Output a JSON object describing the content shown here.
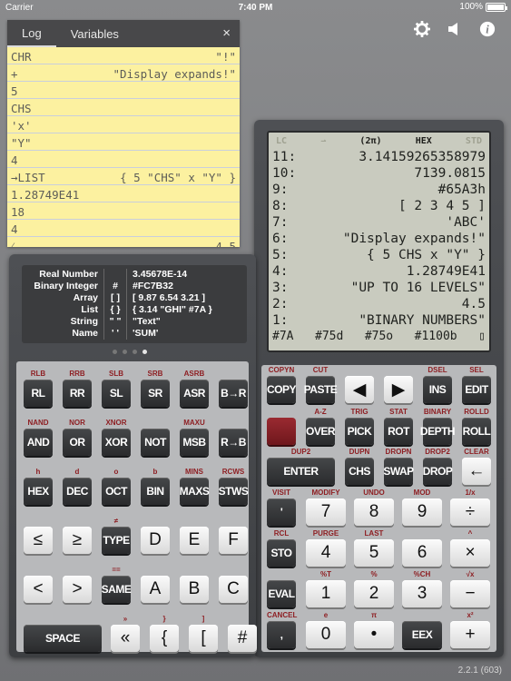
{
  "status": {
    "carrier": "Carrier",
    "time": "7:40 PM",
    "battery": "100%"
  },
  "toolbar": {
    "icons": [
      "gear-icon",
      "speaker-icon",
      "info-icon"
    ]
  },
  "log": {
    "tabs": [
      "Log",
      "Variables"
    ],
    "close": "×",
    "lines": [
      {
        "l": "CHR",
        "r": "\"!\""
      },
      {
        "l": "+",
        "r": "\"Display expands!\""
      },
      {
        "l": "5",
        "r": ""
      },
      {
        "l": "CHS",
        "r": ""
      },
      {
        "l": "'x'",
        "r": ""
      },
      {
        "l": "\"Y\"",
        "r": ""
      },
      {
        "l": "4",
        "r": ""
      },
      {
        "l": "→LIST",
        "r": "{ 5 \"CHS\" x \"Y\" }"
      },
      {
        "l": "1.28749E41",
        "r": ""
      },
      {
        "l": "18",
        "r": ""
      },
      {
        "l": "4",
        "r": ""
      },
      {
        "l": "⁄",
        "r": "4.5"
      }
    ]
  },
  "lcd": {
    "annunciators": {
      "lc": "LC",
      "arrow": "⇀",
      "pi": "(2π)",
      "mode": "HEX",
      "std": "STD"
    },
    "stack": [
      {
        "n": "11:",
        "v": "3.14159265358979"
      },
      {
        "n": "10:",
        "v": "7139.0815"
      },
      {
        "n": "9:",
        "v": "#65A3h"
      },
      {
        "n": "8:",
        "v": "[ 2 3 4 5 ]"
      },
      {
        "n": "7:",
        "v": "'ABC'"
      },
      {
        "n": "6:",
        "v": "\"Display expands!\""
      },
      {
        "n": "5:",
        "v": "{ 5 CHS x \"Y\" }"
      },
      {
        "n": "4:",
        "v": "1.28749E41"
      },
      {
        "n": "3:",
        "v": "\"UP TO 16 LEVELS\""
      },
      {
        "n": "2:",
        "v": "4.5"
      },
      {
        "n": "1:",
        "v": "\"BINARY NUMBERS\""
      }
    ],
    "menu": [
      "#7A",
      "#75d",
      "#75o",
      "#1100b"
    ]
  },
  "types": [
    {
      "name": "Real Number",
      "sym": "",
      "ex": "3.45678E-14"
    },
    {
      "name": "Binary Integer",
      "sym": "#",
      "ex": "#FC7B32"
    },
    {
      "name": "Array",
      "sym": "[ ]",
      "ex": "[ 9.87 6.54 3.21 ]"
    },
    {
      "name": "List",
      "sym": "{ }",
      "ex": "{ 3.14 \"GHI\" #7A }"
    },
    {
      "name": "String",
      "sym": "\" \"",
      "ex": "\"Text\""
    },
    {
      "name": "Name",
      "sym": "' '",
      "ex": "'SUM'"
    }
  ],
  "left_keys": {
    "r1": {
      "shift": [
        "RLB",
        "RRB",
        "SLB",
        "SRB",
        "ASRB",
        ""
      ],
      "keys": [
        "RL",
        "RR",
        "SL",
        "SR",
        "ASR",
        "B→R"
      ]
    },
    "r2": {
      "shift": [
        "NAND",
        "NOR",
        "XNOR",
        "",
        "MAXU",
        ""
      ],
      "keys": [
        "AND",
        "OR",
        "XOR",
        "NOT",
        "MSB",
        "R→B"
      ]
    },
    "r3": {
      "shift": [
        "h",
        "d",
        "o",
        "b",
        "MINS",
        "RCWS"
      ],
      "keys": [
        "HEX",
        "DEC",
        "OCT",
        "BIN",
        "MAXS",
        "STWS"
      ]
    },
    "r4": {
      "shift": [
        "",
        "",
        "≠",
        "",
        "",
        ""
      ],
      "keys": [
        "≤",
        "≥",
        "TYPE",
        "D",
        "E",
        "F"
      ]
    },
    "r5": {
      "shift": [
        "",
        "",
        "==",
        "",
        "",
        ""
      ],
      "keys": [
        "<",
        ">",
        "SAME",
        "A",
        "B",
        "C"
      ]
    },
    "r6": {
      "shift": [
        "",
        "»",
        "}",
        "]",
        ""
      ],
      "keys": [
        "SPACE",
        "«",
        "{",
        "[",
        "#"
      ]
    }
  },
  "right_keys": {
    "r1": {
      "shift": [
        "COPYN",
        "CUT",
        "",
        "",
        "DSEL",
        "SEL"
      ],
      "keys": [
        "COPY",
        "PASTE",
        "◀",
        "▶",
        "INS",
        "EDIT"
      ]
    },
    "r2": {
      "shift": [
        "",
        "A-Z",
        "TRIG",
        "STAT",
        "BINARY",
        "ROLLD"
      ],
      "keys": [
        "",
        "OVER",
        "PICK",
        "ROT",
        "DEPTH",
        "ROLL"
      ]
    },
    "r3": {
      "shift": [
        "DUP2",
        "DUPN",
        "DROPN",
        "DROP2",
        "CLEAR"
      ],
      "keys": [
        "ENTER",
        "CHS",
        "SWAP",
        "DROP",
        "←"
      ]
    },
    "r4": {
      "shift": [
        "VISIT",
        "MODIFY",
        "UNDO",
        "MOD",
        "1/x"
      ],
      "keys": [
        "'",
        "7",
        "8",
        "9",
        "÷"
      ]
    },
    "r5": {
      "shift": [
        "RCL",
        "PURGE",
        "LAST",
        "",
        "^"
      ],
      "keys": [
        "STO",
        "4",
        "5",
        "6",
        "×"
      ]
    },
    "r6": {
      "shift": [
        "",
        "%T",
        "%",
        "%CH",
        "√x"
      ],
      "keys": [
        "EVAL",
        "1",
        "2",
        "3",
        "−"
      ]
    },
    "r7": {
      "shift": [
        "CANCEL",
        "e",
        "π",
        "",
        "x²"
      ],
      "keys": [
        ",",
        "0",
        "•",
        "EEX",
        "+"
      ]
    }
  },
  "version": "2.2.1 (603)"
}
